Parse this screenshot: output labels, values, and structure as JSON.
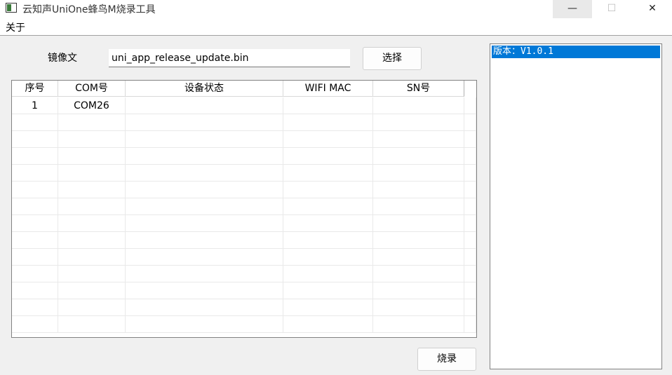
{
  "window": {
    "title": "云知声UniOne蜂鸟M烧录工具",
    "min_glyph": "—",
    "max_glyph": "☐",
    "close_glyph": "✕"
  },
  "menu": {
    "items": [
      "关于"
    ]
  },
  "file": {
    "label": "镜像文",
    "value": "uni_app_release_update.bin",
    "choose_label": "选择"
  },
  "table": {
    "columns": [
      "序号",
      "COM号",
      "设备状态",
      "WIFI MAC",
      "SN号"
    ],
    "rows": [
      [
        "1",
        "COM26",
        "",
        "",
        ""
      ]
    ]
  },
  "version_list": {
    "items": [
      "版本：V1.0.1"
    ]
  },
  "actions": {
    "burn_label": "烧录"
  },
  "colors": {
    "selection": "#0078d7",
    "window_bg": "#f0f0f0"
  }
}
